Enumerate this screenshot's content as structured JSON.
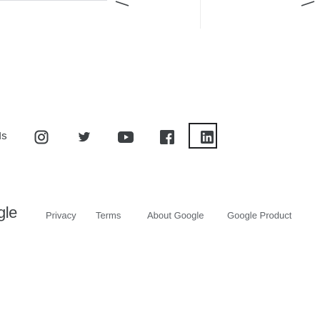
{
  "social": {
    "leading_text": "Is",
    "items": [
      {
        "name": "instagram",
        "icon": "instagram-icon"
      },
      {
        "name": "twitter",
        "icon": "twitter-icon"
      },
      {
        "name": "youtube",
        "icon": "youtube-icon"
      },
      {
        "name": "facebook",
        "icon": "facebook-icon"
      },
      {
        "name": "linkedin",
        "icon": "linkedin-icon"
      }
    ]
  },
  "footer": {
    "brand_tail": "gle",
    "links": [
      "Privacy",
      "Terms",
      "About Google",
      "Google Product"
    ]
  },
  "colors": {
    "icon": "#3c4043",
    "text": "#5f6368",
    "highlight": "#202124"
  }
}
